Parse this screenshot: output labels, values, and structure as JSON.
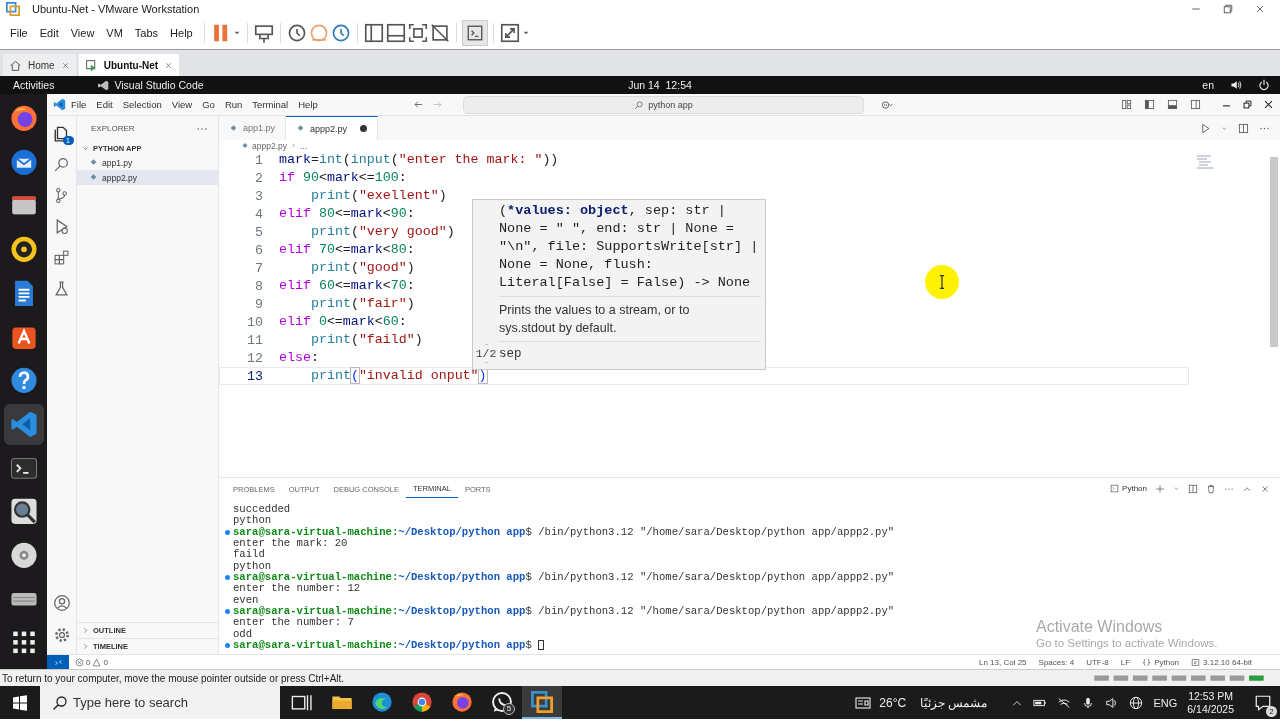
{
  "vmware": {
    "title": "Ubuntu-Net - VMware Workstation",
    "menu": [
      "File",
      "Edit",
      "View",
      "VM",
      "Tabs",
      "Help"
    ],
    "tabs": [
      {
        "label": "Home",
        "selected": false
      },
      {
        "label": "Ubuntu-Net",
        "selected": true
      }
    ],
    "status_message": "To return to your computer, move the mouse pointer outside or press Ctrl+Alt."
  },
  "ubuntu_bar": {
    "activities": "Activities",
    "app_name": "Visual Studio Code",
    "clock": "Jun 14  12:54",
    "input_source": "en"
  },
  "dock": {
    "items": [
      {
        "kind": "browser",
        "selected": false
      },
      {
        "kind": "mail",
        "selected": false
      },
      {
        "kind": "files",
        "selected": false
      },
      {
        "kind": "music",
        "selected": false
      },
      {
        "kind": "writer",
        "selected": false
      },
      {
        "kind": "store",
        "selected": false
      },
      {
        "kind": "help",
        "selected": false
      },
      {
        "kind": "code",
        "selected": true
      },
      {
        "kind": "terminal",
        "selected": false
      },
      {
        "kind": "magnifier",
        "selected": false
      },
      {
        "kind": "disc",
        "selected": false
      },
      {
        "kind": "drive",
        "selected": false
      },
      {
        "kind": "apps",
        "selected": false
      }
    ]
  },
  "vscode": {
    "menu": [
      "File",
      "Edit",
      "Selection",
      "View",
      "Go",
      "Run",
      "Terminal",
      "Help"
    ],
    "command_center": {
      "value": "python app"
    },
    "explorer": {
      "title": "EXPLORER",
      "badge": "1",
      "folder": "PYTHON APP",
      "files": [
        {
          "name": "app1.py",
          "selected": false
        },
        {
          "name": "appp2.py",
          "selected": true
        }
      ],
      "sections": [
        "OUTLINE",
        "TIMELINE"
      ]
    },
    "tabs": [
      {
        "label": "app1.py",
        "selected": false,
        "modified": false
      },
      {
        "label": "appp2.py",
        "selected": true,
        "modified": true
      }
    ],
    "breadcrumb": [
      "appp2.py",
      "..."
    ],
    "editor": {
      "lines": [
        {
          "number": "1",
          "indented": false,
          "current": false,
          "tokens": [
            {
              "kind": "variable",
              "text": "mark"
            },
            {
              "kind": "punct",
              "text": "="
            },
            {
              "kind": "builtin",
              "text": "int"
            },
            {
              "kind": "punct",
              "text": "("
            },
            {
              "kind": "builtin",
              "text": "input"
            },
            {
              "kind": "punct",
              "text": "("
            },
            {
              "kind": "string",
              "text": "\"enter the mark: \""
            },
            {
              "kind": "punct",
              "text": "))"
            }
          ]
        },
        {
          "number": "2",
          "indented": false,
          "current": false,
          "tokens": [
            {
              "kind": "keyword",
              "text": "if "
            },
            {
              "kind": "number",
              "text": "90"
            },
            {
              "kind": "punct",
              "text": "<"
            },
            {
              "kind": "variable",
              "text": "mark"
            },
            {
              "kind": "punct",
              "text": "<="
            },
            {
              "kind": "number",
              "text": "100"
            },
            {
              "kind": "punct",
              "text": ":"
            }
          ]
        },
        {
          "number": "3",
          "indented": true,
          "current": false,
          "tokens": [
            {
              "kind": "builtin",
              "text": "print"
            },
            {
              "kind": "punct",
              "text": "("
            },
            {
              "kind": "string",
              "text": "\"exellent\""
            },
            {
              "kind": "punct",
              "text": ")"
            }
          ]
        },
        {
          "number": "4",
          "indented": false,
          "current": false,
          "tokens": [
            {
              "kind": "keyword",
              "text": "elif "
            },
            {
              "kind": "number",
              "text": "80"
            },
            {
              "kind": "punct",
              "text": "<="
            },
            {
              "kind": "variable",
              "text": "mark"
            },
            {
              "kind": "punct",
              "text": "<"
            },
            {
              "kind": "number",
              "text": "90"
            },
            {
              "kind": "punct",
              "text": ":"
            }
          ]
        },
        {
          "number": "5",
          "indented": true,
          "current": false,
          "tokens": [
            {
              "kind": "builtin",
              "text": "print"
            },
            {
              "kind": "punct",
              "text": "("
            },
            {
              "kind": "string",
              "text": "\"very good\""
            },
            {
              "kind": "punct",
              "text": ")"
            }
          ]
        },
        {
          "number": "6",
          "indented": false,
          "current": false,
          "tokens": [
            {
              "kind": "keyword",
              "text": "elif "
            },
            {
              "kind": "number",
              "text": "70"
            },
            {
              "kind": "punct",
              "text": "<="
            },
            {
              "kind": "variable",
              "text": "mark"
            },
            {
              "kind": "punct",
              "text": "<"
            },
            {
              "kind": "number",
              "text": "80"
            },
            {
              "kind": "punct",
              "text": ":"
            }
          ]
        },
        {
          "number": "7",
          "indented": true,
          "current": false,
          "tokens": [
            {
              "kind": "builtin",
              "text": "print"
            },
            {
              "kind": "punct",
              "text": "("
            },
            {
              "kind": "string",
              "text": "\"good\""
            },
            {
              "kind": "punct",
              "text": ")"
            }
          ]
        },
        {
          "number": "8",
          "indented": false,
          "current": false,
          "tokens": [
            {
              "kind": "keyword",
              "text": "elif "
            },
            {
              "kind": "number",
              "text": "60"
            },
            {
              "kind": "punct",
              "text": "<="
            },
            {
              "kind": "variable",
              "text": "mark"
            },
            {
              "kind": "punct",
              "text": "<"
            },
            {
              "kind": "number",
              "text": "70"
            },
            {
              "kind": "punct",
              "text": ":"
            }
          ]
        },
        {
          "number": "9",
          "indented": true,
          "current": false,
          "tokens": [
            {
              "kind": "builtin",
              "text": "print"
            },
            {
              "kind": "punct",
              "text": "("
            },
            {
              "kind": "string",
              "text": "\"fair\""
            },
            {
              "kind": "punct",
              "text": ")"
            }
          ]
        },
        {
          "number": "10",
          "indented": false,
          "current": false,
          "tokens": [
            {
              "kind": "keyword",
              "text": "elif "
            },
            {
              "kind": "number",
              "text": "0"
            },
            {
              "kind": "punct",
              "text": "<="
            },
            {
              "kind": "variable",
              "text": "mark"
            },
            {
              "kind": "punct",
              "text": "<"
            },
            {
              "kind": "number",
              "text": "60"
            },
            {
              "kind": "punct",
              "text": ":"
            }
          ]
        },
        {
          "number": "11",
          "indented": true,
          "current": false,
          "tokens": [
            {
              "kind": "builtin",
              "text": "print"
            },
            {
              "kind": "punct",
              "text": "("
            },
            {
              "kind": "string",
              "text": "\"faild\""
            },
            {
              "kind": "punct",
              "text": ")"
            }
          ]
        },
        {
          "number": "12",
          "indented": false,
          "current": false,
          "tokens": [
            {
              "kind": "keyword",
              "text": "else"
            },
            {
              "kind": "punct",
              "text": ":"
            }
          ]
        },
        {
          "number": "13",
          "indented": true,
          "current": true,
          "tokens": [
            {
              "kind": "builtin",
              "text": "print"
            },
            {
              "kind": "bracket",
              "text": "("
            },
            {
              "kind": "string",
              "text": "\"invalid onput\""
            },
            {
              "kind": "bracket",
              "text": ")"
            }
          ]
        }
      ]
    },
    "signature_help": {
      "signature": [
        {
          "text": "(",
          "active": false
        },
        {
          "text": "*values: object",
          "active": true
        },
        {
          "text": ", sep: str | None = \" \", end: str | None = \"\\n\", file: SupportsWrite[str] | None = None, flush: Literal[False] = False) -> None",
          "active": false
        }
      ],
      "documentation": "Prints the values to a stream, or to sys.stdout by default.",
      "counter": "1/2",
      "parameter": "sep"
    },
    "panel": {
      "tabs": [
        {
          "label": "PROBLEMS",
          "selected": false
        },
        {
          "label": "OUTPUT",
          "selected": false
        },
        {
          "label": "DEBUG CONSOLE",
          "selected": false
        },
        {
          "label": "TERMINAL",
          "selected": true
        },
        {
          "label": "PORTS",
          "selected": false
        }
      ],
      "terminal_profile": "Python",
      "lines": [
        {
          "kind": "output",
          "text": "succedded"
        },
        {
          "kind": "output",
          "text": "python"
        },
        {
          "kind": "prompt",
          "user": "sara@sara-virtual-machine:",
          "path": "~/Desktop/python app",
          "command": "$ /bin/python3.12 \"/home/sara/Desktop/python app/appp2.py\""
        },
        {
          "kind": "output",
          "text": "enter the mark: 20"
        },
        {
          "kind": "output",
          "text": "faild"
        },
        {
          "kind": "output",
          "text": "python"
        },
        {
          "kind": "prompt",
          "user": "sara@sara-virtual-machine:",
          "path": "~/Desktop/python app",
          "command": "$ /bin/python3.12 \"/home/sara/Desktop/python app/appp2.py\""
        },
        {
          "kind": "output",
          "text": "enter the number: 12"
        },
        {
          "kind": "output",
          "text": "even"
        },
        {
          "kind": "prompt",
          "user": "sara@sara-virtual-machine:",
          "path": "~/Desktop/python app",
          "command": "$ /bin/python3.12 \"/home/sara/Desktop/python app/appp2.py\""
        },
        {
          "kind": "output",
          "text": "enter the number: 7"
        },
        {
          "kind": "output",
          "text": "odd"
        },
        {
          "kind": "cursor-prompt",
          "user": "sara@sara-virtual-machine:",
          "path": "~/Desktop/python app",
          "command": "$"
        }
      ]
    },
    "status_bar": {
      "errors": "0",
      "warnings": "0",
      "position": "Ln 13, Col 25",
      "indentation": "Spaces: 4",
      "encoding": "UTF-8",
      "eol": "LF",
      "language": "Python",
      "interpreter": "3.12.10 64-bit"
    }
  },
  "watermark": {
    "title": "Activate Windows",
    "subtitle": "Go to Settings to activate Windows."
  },
  "taskbar": {
    "search": {
      "placeholder": "Type here to search"
    },
    "apps": [
      {
        "kind": "task-view",
        "selected": false
      },
      {
        "kind": "files",
        "selected": false
      },
      {
        "kind": "edge",
        "selected": false
      },
      {
        "kind": "chrome",
        "selected": false
      },
      {
        "kind": "firefox",
        "selected": false
      },
      {
        "kind": "whatsapp",
        "selected": false,
        "badge": "5"
      },
      {
        "kind": "vmware",
        "selected": true
      }
    ],
    "weather": {
      "temperature": "26°C",
      "condition": "مشمس جزئيًا"
    },
    "language": "ENG",
    "time": "12:53 PM",
    "date": "6/14/2025",
    "notifications": "2"
  }
}
